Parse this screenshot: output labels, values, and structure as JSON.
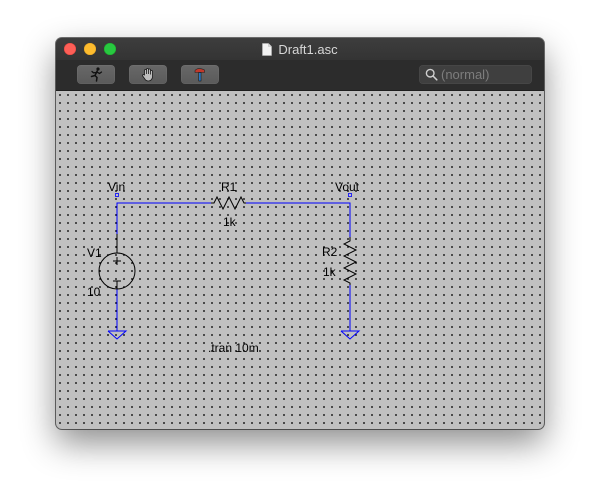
{
  "window": {
    "title": "Draft1.asc"
  },
  "toolbar": {
    "buttons": [
      {
        "name": "run",
        "icon": "running-man-icon"
      },
      {
        "name": "halt",
        "icon": "hand-icon"
      },
      {
        "name": "tools",
        "icon": "hammer-icon"
      }
    ],
    "search_placeholder": "(normal)"
  },
  "schematic": {
    "wire_color": "#0000ff",
    "background_color": "#c0c0c0",
    "net_labels": {
      "vin": "Vin",
      "vout": "Vout"
    },
    "components": {
      "v1": {
        "name": "V1",
        "value": "10"
      },
      "r1": {
        "name": "R1",
        "value": "1k"
      },
      "r2": {
        "name": "R2",
        "value": "1k"
      }
    },
    "directive": ".tran 10m"
  }
}
